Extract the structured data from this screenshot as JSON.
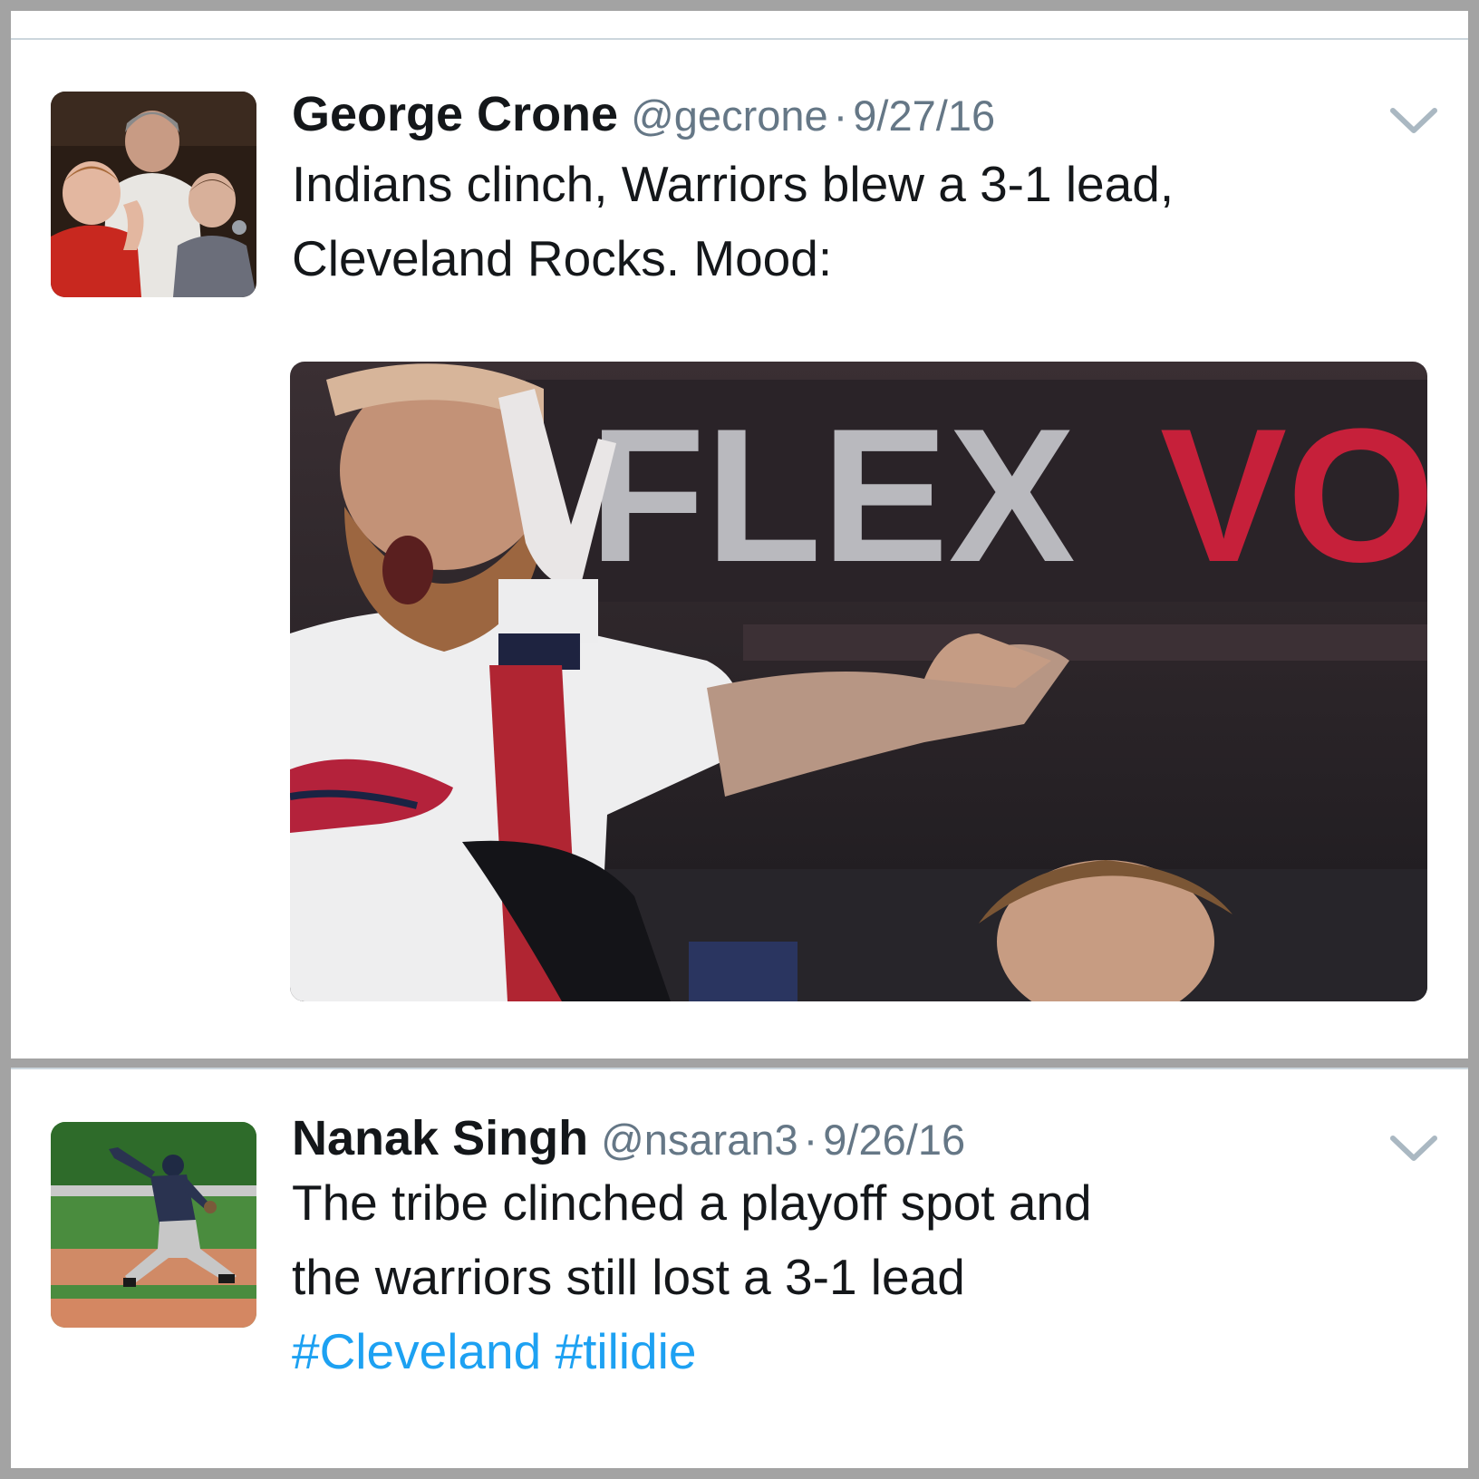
{
  "tweets": [
    {
      "display_name": "George Crone",
      "handle": "@gecrone",
      "separator": "·",
      "date": "9/27/16",
      "text_lines": [
        "Indians clinch, Warriors blew a 3-1 lead,",
        "Cleveland Rocks. Mood:"
      ],
      "media": {
        "kind": "gif-still",
        "banner_text_white": "FLEX",
        "banner_text_red": "VO"
      },
      "avatar": "family-photo"
    },
    {
      "display_name": "Nanak Singh",
      "handle": "@nsaran3",
      "separator": "·",
      "date": "9/26/16",
      "text_lines": [
        "The tribe clinched a playoff spot and",
        "the warriors still lost a 3-1 lead"
      ],
      "hashtags": [
        "#Cleveland",
        "#tilidie"
      ],
      "avatar": "baseball-pitcher-photo"
    }
  ],
  "colors": {
    "hashtag": "#1da1f2",
    "text": "#14171a",
    "secondary": "#657786",
    "divider": "#ccd6dd",
    "outer_border": "#a3a3a3"
  },
  "icons": {
    "menu": "chevron-down-icon"
  }
}
